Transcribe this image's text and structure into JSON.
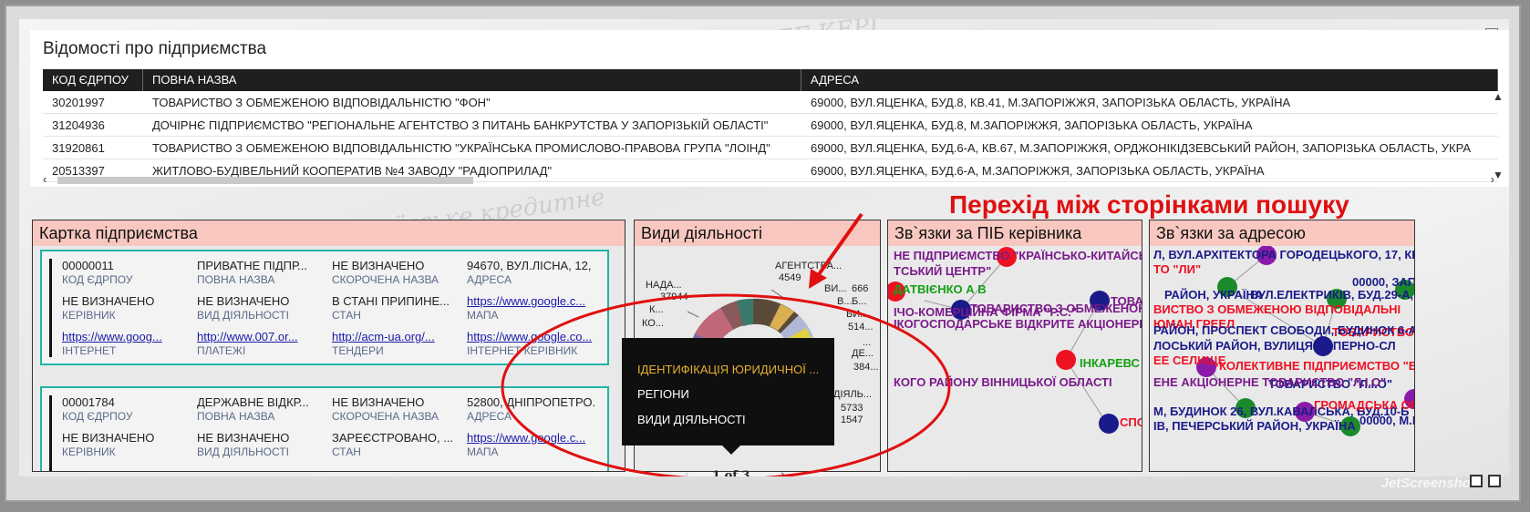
{
  "companies_table": {
    "title": "Відомості про підприємства",
    "columns": [
      "КОД ЄДРПОУ",
      "ПОВНА НАЗВА",
      "АДРЕСА"
    ],
    "rows": [
      [
        "30201997",
        "ТОВАРИСТВО З ОБМЕЖЕНОЮ ВІДПОВІДАЛЬНІСТЮ \"ФОН\"",
        "69000, ВУЛ.ЯЦЕНКА, БУД.8, КВ.41, М.ЗАПОРІЖЖЯ, ЗАПОРІЗЬКА ОБЛАСТЬ, УКРАЇНА"
      ],
      [
        "31204936",
        "ДОЧІРНЄ ПІДПРИЄМСТВО \"РЕГІОНАЛЬНЕ АГЕНТСТВО З ПИТАНЬ БАНКРУТСТВА У ЗАПОРІЗЬКІЙ ОБЛАСТІ\"",
        "69000, ВУЛ.ЯЦЕНКА, БУД.8, М.ЗАПОРІЖЖЯ, ЗАПОРІЗЬКА ОБЛАСТЬ, УКРАЇНА"
      ],
      [
        "31920861",
        "ТОВАРИСТВО З ОБМЕЖЕНОЮ ВІДПОВІДАЛЬНІСТЮ \"УКРАЇНСЬКА ПРОМИСЛОВО-ПРАВОВА ГРУПА \"ЛОІНД\"",
        "69000, ВУЛ.ЯЦЕНКА, БУД.6-А, КВ.67, М.ЗАПОРІЖЖЯ, ОРДЖОНІКІДЗЕВСЬКИЙ РАЙОН, ЗАПОРІЗЬКА ОБЛАСТЬ, УКРА"
      ],
      [
        "20513397",
        "ЖИТЛОВО-БУДІВЕЛЬНИЙ КООПЕРАТИВ №4 ЗАВОДУ \"РАДІОПРИЛАД\"",
        "69000, ВУЛ.ЯЦЕНКА, БУД.6-А, М.ЗАПОРІЖЖЯ, ЗАПОРІЗЬКА ОБЛАСТЬ, УКРАЇНА"
      ]
    ]
  },
  "annotation": "Перехід між сторінками пошуку",
  "company_card": {
    "title": "Картка підприємства",
    "records": [
      {
        "fields": [
          {
            "value": "00000011",
            "label": "КОД ЄДРПОУ",
            "link": false
          },
          {
            "value": "ПРИВАТНЕ ПІДПР...",
            "label": "ПОВНА НАЗВА",
            "link": false
          },
          {
            "value": "НЕ ВИЗНАЧЕНО",
            "label": "СКОРОЧЕНА НАЗВА",
            "link": false
          },
          {
            "value": "94670, ВУЛ.ЛІСНА, 12, ...",
            "label": "АДРЕСА",
            "link": false
          },
          {
            "value": "НЕ ВИЗНАЧЕНО",
            "label": "КЕРІВНИК",
            "link": false
          },
          {
            "value": "НЕ ВИЗНАЧЕНО",
            "label": "ВИД ДІЯЛЬНОСТІ",
            "link": false
          },
          {
            "value": "В СТАНІ ПРИПИНЕ...",
            "label": "СТАН",
            "link": false
          },
          {
            "value": "https://www.google.c...",
            "label": "МАПА",
            "link": true
          },
          {
            "value": "https://www.goog...",
            "label": "ІНТЕРНЕТ",
            "link": true
          },
          {
            "value": "http://www.007.or...",
            "label": "ПЛАТЕЖІ",
            "link": true
          },
          {
            "value": "http://acm-ua.org/...",
            "label": "ТЕНДЕРИ",
            "link": true
          },
          {
            "value": "https://www.google.co...",
            "label": "ІНТЕРНЕТ КЕРІВНИК",
            "link": true
          }
        ]
      },
      {
        "fields": [
          {
            "value": "00001784",
            "label": "КОД ЄДРПОУ",
            "link": false
          },
          {
            "value": "ДЕРЖАВНЕ ВІДКР...",
            "label": "ПОВНА НАЗВА",
            "link": false
          },
          {
            "value": "НЕ ВИЗНАЧЕНО",
            "label": "СКОРОЧЕНА НАЗВА",
            "link": false
          },
          {
            "value": "52800, ДНІПРОПЕТРО...",
            "label": "АДРЕСА",
            "link": false
          },
          {
            "value": "НЕ ВИЗНАЧЕНО",
            "label": "КЕРІВНИК",
            "link": false
          },
          {
            "value": "НЕ ВИЗНАЧЕНО",
            "label": "ВИД ДІЯЛЬНОСТІ",
            "link": false
          },
          {
            "value": "ЗАРЕЄСТРОВАНО, ...",
            "label": "СТАН",
            "link": false
          },
          {
            "value": "https://www.google.c...",
            "label": "МАПА",
            "link": true
          }
        ]
      }
    ]
  },
  "activities": {
    "title": "Види діяльності",
    "labels": [
      "АГЕНТСТВА...",
      "4549",
      "НАДА...",
      "37944",
      "К...",
      "КО...",
      "ВИ...",
      "666",
      "В...",
      "Б...",
      "БИ...",
      "514...",
      "...",
      "ДЕ...",
      "384...",
      "ДІЯЛЬ...",
      "5733",
      "1547"
    ]
  },
  "leader_links": {
    "title": "Зв`язки за ПІБ керівника",
    "texts": [
      "НЕ ПІДПРИЄМСТВО \"КРАЇНСЬКО-КИТАЙСЬКИ",
      "ТСЬКИЙ ЦЕНТР\"",
      "ДАТВІЄНКО А В",
      "ТОВАРИСТВО З ОБМЕЖЕНОЮ",
      "ІЧО-КОМЕРЦІЙНА ФІРМА \"Р.С.\"",
      "ТОВАРИ",
      "ІКОГОСПОДАРСЬКЕ ВІДКРИТЕ АКЦІОНЕРНЕ Т",
      "ІНКАРЕВС",
      "КОГО РАЙОНУ ВІННИЦЬКОЇ ОБЛАСТІ",
      "СПО"
    ]
  },
  "address_links": {
    "title": "Зв`язки за адресою",
    "texts": [
      "Л, ВУЛ.АРХІТЕКТОРА ГОРОДЕЦЬКОГО, 17, КВ.",
      "ТО \"ЛИ\"",
      "00000, ЗАПО",
      "РАЙОН, УКРАЇНА",
      "ВУЛ.ЕЛЕКТРИКІВ, БУД.29-А, МІС",
      "ВИСТВО З ОБМЕЖЕНОЮ ВІДПОВІДАЛЬНІ",
      "ЮМАН ГРЕЕЛ",
      "ТОВАРИСТВО З",
      "РАЙОН, ПРОСПЕКТ СВОБОДИ, БУДИНОК 6-А",
      "ЛОСЬКИЙ РАЙОН, ВУЛИЦЯ САПЕРНО-СЛ",
      "ЕЕ СЕЛИЩЕ",
      "КОЛЕКТИВНЕ ПІДПРИЄМСТВО \"БЛА",
      "ТОВАРИСТВО \"Л.І.О\"",
      "ЕНЕ АКЦІОНЕРНЕ ТОВАРИСТВО \"Л.І.О\"",
      "М, БУДИНОК 26, ВУЛ.КАВАЛСЬКА, БУД.10-Б",
      "ГРОМАДСЬКА ОРГ",
      "ІВ, ПЕЧЕРСЬКИЙ РАЙОН, УКРАЇНА",
      "00000, М.К"
    ]
  },
  "tooltip_menu": {
    "items": [
      "ІДЕНТИФІКАЦІЯ ЮРИДИЧНОЇ ...",
      "РЕГІОНИ",
      "ВИДИ ДІЯЛЬНОСТІ"
    ],
    "selected_index": 0
  },
  "pager": {
    "prev": "‹",
    "text": "1 of 3",
    "next": "›"
  },
  "watermark": "JetScreenshot",
  "colors": {
    "annotation": "#e01010",
    "accent": "#21b4a6",
    "card_title_bg": "#f8c8c0",
    "link": "#1a1aa8"
  },
  "background_text": [
    "історій „Українське кредитне",
    "ЕЕ КЕРІ"
  ]
}
